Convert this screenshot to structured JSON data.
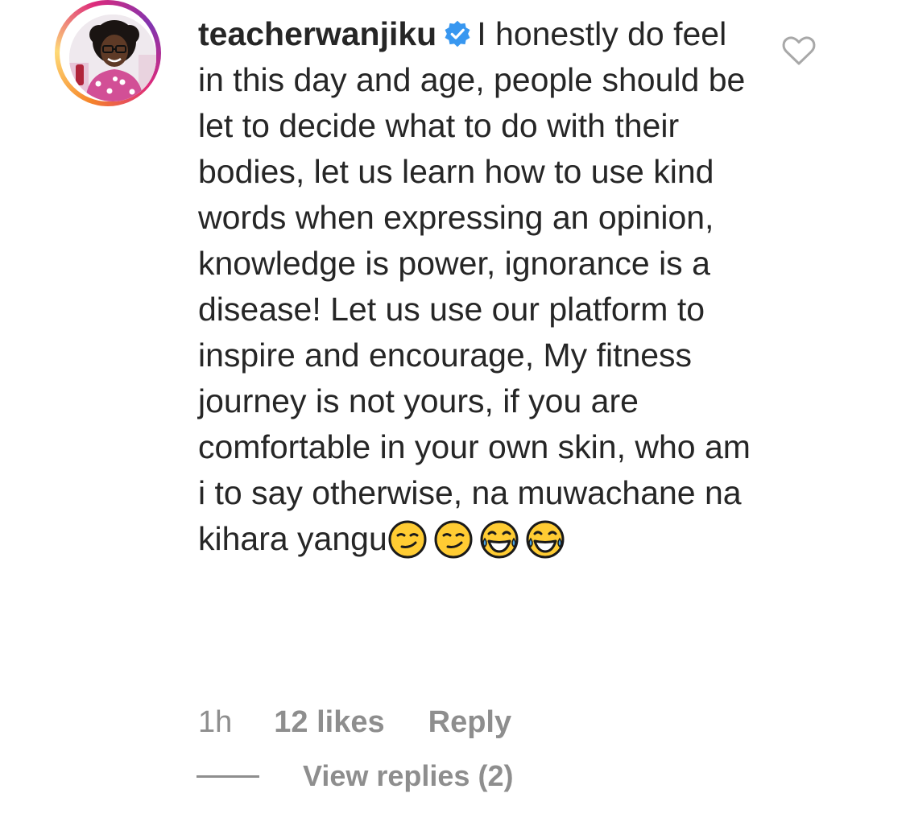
{
  "comment": {
    "username": "teacherwanjiku",
    "verified": true,
    "text": "I honestly do feel in this day and age, people should be let to decide what to do with their bodies, let us learn how to use kind words when expressing an opinion, knowledge is power, ignorance is a disease! Let us use our platform to inspire and encourage, My fitness journey is not yours, if you are comfortable in your own skin, who am i to say otherwise, na muwachane na kihara yangu",
    "emojis": [
      "smirking-face",
      "smirking-face",
      "face-with-tears-of-joy",
      "face-with-tears-of-joy"
    ],
    "time": "1h",
    "likes": "12 likes",
    "reply_label": "Reply",
    "view_replies_label": "View replies (2)"
  },
  "icons": {
    "verified": "verified-badge-icon",
    "like": "heart-outline-icon"
  },
  "colors": {
    "text": "#262626",
    "muted": "#8e8e8e",
    "verified": "#3897f0",
    "emoji": "#ffcc33"
  }
}
